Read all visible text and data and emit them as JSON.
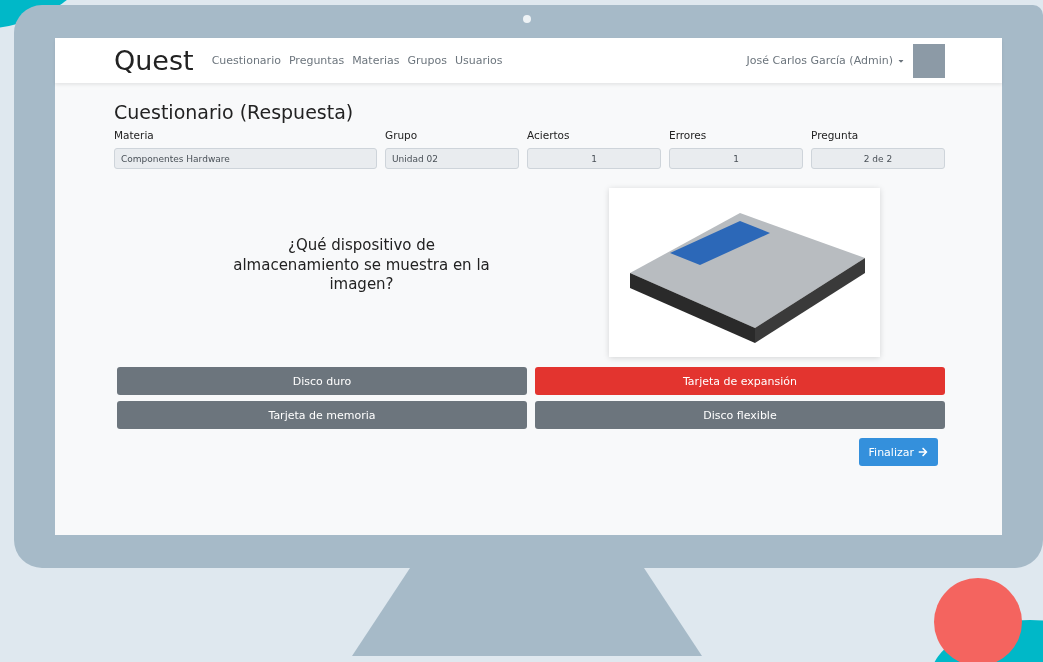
{
  "navbar": {
    "brand": "Quest",
    "links": [
      "Cuestionario",
      "Preguntas",
      "Materias",
      "Grupos",
      "Usuarios"
    ],
    "user": "José Carlos García (Admin)"
  },
  "title": "Cuestionario (Respuesta)",
  "fields": [
    {
      "label": "Materia",
      "value": "Componentes Hardware",
      "kind": "text"
    },
    {
      "label": "Grupo",
      "value": "Unidad 02",
      "kind": "text"
    },
    {
      "label": "Aciertos",
      "value": "1",
      "kind": "number"
    },
    {
      "label": "Errores",
      "value": "1",
      "kind": "number"
    },
    {
      "label": "Pregunta",
      "value": "2 de 2",
      "kind": "number"
    }
  ],
  "question": "¿Qué dispositivo de almacenamiento se muestra en la imagen?",
  "answers": [
    {
      "label": "Disco duro",
      "selected": false
    },
    {
      "label": "Tarjeta de expansión",
      "selected": true
    },
    {
      "label": "Tarjeta de memoria",
      "selected": false
    },
    {
      "label": "Disco flexible",
      "selected": false
    }
  ],
  "finish_button": "Finalizar"
}
